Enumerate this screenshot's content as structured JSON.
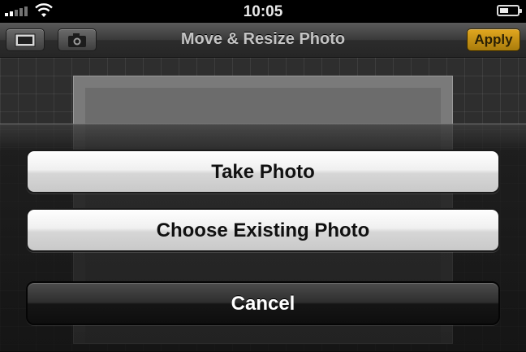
{
  "status_bar": {
    "time": "10:05"
  },
  "navbar": {
    "title": "Move & Resize Photo",
    "apply_label": "Apply"
  },
  "action_sheet": {
    "take_photo": "Take Photo",
    "choose_existing": "Choose Existing Photo",
    "cancel": "Cancel"
  },
  "colors": {
    "apply_accent": "#d49a18",
    "navbar_title": "#c4c4c4"
  }
}
